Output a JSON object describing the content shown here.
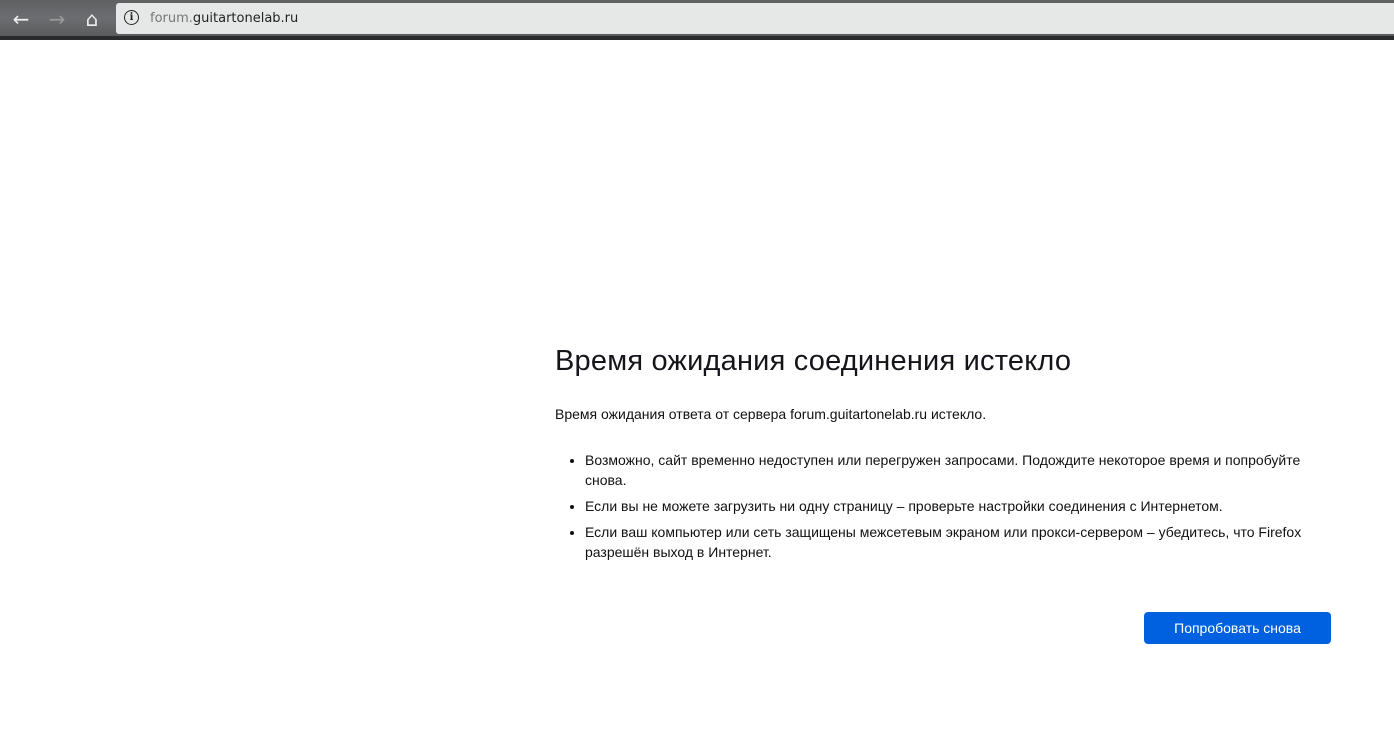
{
  "browser": {
    "url_host_prefix": "forum.",
    "url_domain": "guitartonelab.ru",
    "back_icon": "←",
    "forward_icon": "→",
    "home_icon": "⌂",
    "info_icon": "i"
  },
  "error": {
    "title": "Время ожидания соединения истекло",
    "description": "Время ожидания ответа от сервера forum.guitartonelab.ru истекло.",
    "suggestions": [
      "Возможно, сайт временно недоступен или перегружен запросами. Подождите некоторое время и попробуйте снова.",
      "Если вы не можете загрузить ни одну страницу – проверьте настройки соединения с Интернетом.",
      "Если ваш компьютер или сеть защищены межсетевым экраном или прокси-сервером – убедитесь, что Firefox разрешён выход в Интернет."
    ],
    "retry_label": "Попробовать снова"
  }
}
